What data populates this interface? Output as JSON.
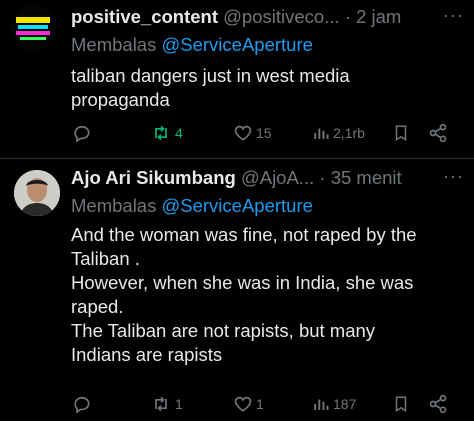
{
  "tweets": [
    {
      "display_name": "positive_content",
      "handle_time": "@positiveco...",
      "sep": "·",
      "time": "2 jam",
      "reply_prefix": "Membalas ",
      "reply_to": "@ServiceAperture",
      "text": "taliban dangers just in west media\npropaganda",
      "retweets": "4",
      "likes": "15",
      "views": "2,1rb",
      "retweet_color": "#00ba7c"
    },
    {
      "display_name": "Ajo Ari Sikumbang",
      "handle_time": "@AjoA...",
      "sep": "·",
      "time": "35 menit",
      "reply_prefix": "Membalas ",
      "reply_to": "@ServiceAperture",
      "text": "And the woman was fine, not raped by the\nTaliban .\nHowever, when she was in India, she was\nraped.\nThe Taliban are not rapists, but many\nIndians are rapists",
      "retweets": "1",
      "likes": "1",
      "views": "187"
    }
  ],
  "more_icon": "···",
  "icons": [
    "avatar",
    "reply-icon",
    "retweet-icon",
    "like-icon",
    "views-icon",
    "bookmark-icon",
    "share-icon",
    "more-icon"
  ],
  "colors": {
    "background": "#000000",
    "text": "#e7e9ea",
    "muted": "#71767b",
    "link": "#1d9bf0",
    "retweet_active": "#00ba7c"
  }
}
